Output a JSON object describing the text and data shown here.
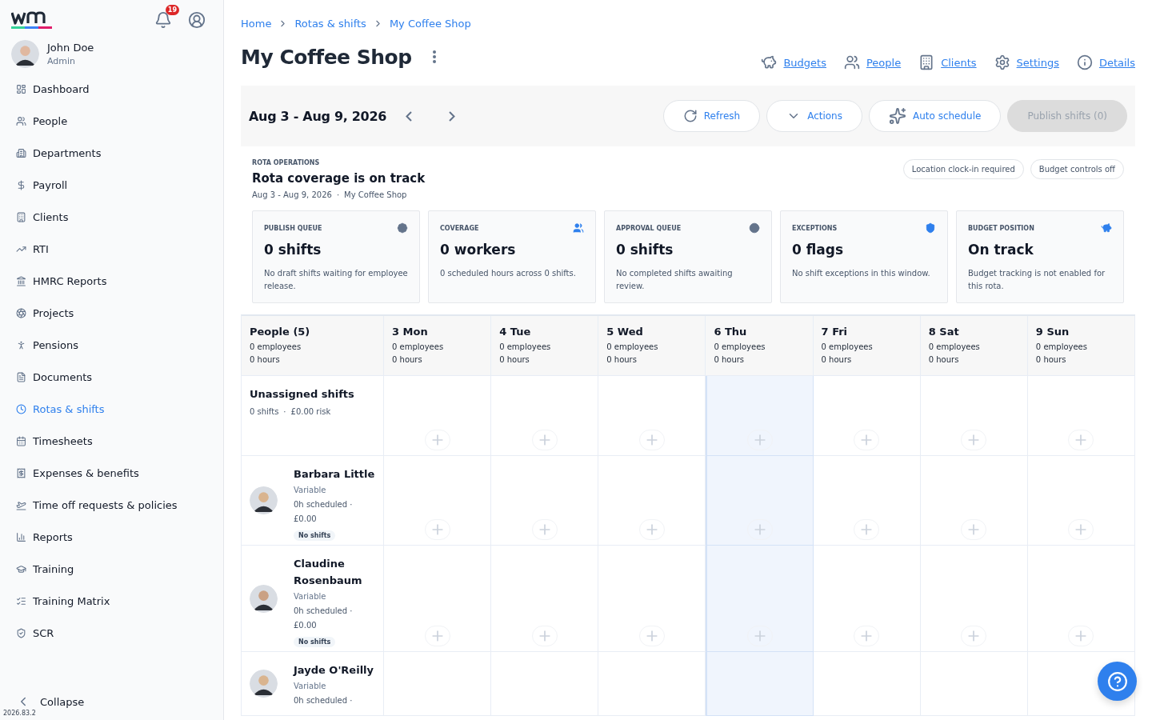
{
  "sidebar": {
    "notifications": "19",
    "user": {
      "name": "John Doe",
      "role": "Admin"
    },
    "items": [
      {
        "label": "Dashboard",
        "selected": false
      },
      {
        "label": "People",
        "selected": false
      },
      {
        "label": "Departments",
        "selected": false
      },
      {
        "label": "Payroll",
        "selected": false
      },
      {
        "label": "Clients",
        "selected": false
      },
      {
        "label": "RTI",
        "selected": false
      },
      {
        "label": "HMRC Reports",
        "selected": false
      },
      {
        "label": "Projects",
        "selected": false
      },
      {
        "label": "Pensions",
        "selected": false
      },
      {
        "label": "Documents",
        "selected": false
      },
      {
        "label": "Rotas & shifts",
        "selected": true
      },
      {
        "label": "Timesheets",
        "selected": false
      },
      {
        "label": "Expenses & benefits",
        "selected": false
      },
      {
        "label": "Time off requests & policies",
        "selected": false
      },
      {
        "label": "Reports",
        "selected": false
      },
      {
        "label": "Training",
        "selected": false
      },
      {
        "label": "Training Matrix",
        "selected": false
      },
      {
        "label": "SCR",
        "selected": false
      }
    ],
    "collapse": "Collapse",
    "version": "2026.83.2"
  },
  "breadcrumbs": [
    "Home",
    "Rotas & shifts",
    "My Coffee Shop"
  ],
  "title": "My Coffee Shop",
  "header_links": [
    "Budgets",
    "People",
    "Clients",
    "Settings",
    "Details"
  ],
  "toolbar": {
    "range": "Aug 3 - Aug 9, 2026",
    "buttons": [
      {
        "label": "Refresh",
        "disabled": false
      },
      {
        "label": "Actions",
        "disabled": false
      },
      {
        "label": "Auto schedule",
        "disabled": false
      },
      {
        "label": "Publish shifts (0)",
        "disabled": true
      }
    ]
  },
  "operations": {
    "eyebrow": "ROTA OPERATIONS",
    "heading": "Rota coverage is on track",
    "meta": [
      "Aug 3 - Aug 9, 2026",
      "My Coffee Shop"
    ],
    "meta_separator": "·",
    "tags": [
      "Location clock-in required",
      "Budget controls off"
    ],
    "cards": [
      {
        "label": "PUBLISH QUEUE",
        "value": "0 shifts",
        "description": "No draft shifts waiting for employee release.",
        "color": "#64748b"
      },
      {
        "label": "COVERAGE",
        "value": "0 workers",
        "description": "0 scheduled hours across 0 shifts.",
        "color": "#2f80ed"
      },
      {
        "label": "APPROVAL QUEUE",
        "value": "0 shifts",
        "description": "No completed shifts awaiting review.",
        "color": "#64748b"
      },
      {
        "label": "EXCEPTIONS",
        "value": "0 flags",
        "description": "No shift exceptions in this window.",
        "color": "#2f80ed"
      },
      {
        "label": "BUDGET POSITION",
        "value": "On track",
        "description": "Budget tracking is not enabled for this rota.",
        "color": "#2f80ed"
      }
    ]
  },
  "rota": {
    "people_header": {
      "title": "People (5)",
      "employees": "0 employees",
      "hours": "0 hours"
    },
    "days": [
      {
        "label": "3 Mon",
        "employees": "0 employees",
        "hours": "0 hours",
        "selected": false
      },
      {
        "label": "4 Tue",
        "employees": "0 employees",
        "hours": "0 hours",
        "selected": false
      },
      {
        "label": "5 Wed",
        "employees": "0 employees",
        "hours": "0 hours",
        "selected": false
      },
      {
        "label": "6 Thu",
        "employees": "0 employees",
        "hours": "0 hours",
        "selected": true
      },
      {
        "label": "7 Fri",
        "employees": "0 employees",
        "hours": "0 hours",
        "selected": false
      },
      {
        "label": "8 Sat",
        "employees": "0 employees",
        "hours": "0 hours",
        "selected": false
      },
      {
        "label": "9 Sun",
        "employees": "0 employees",
        "hours": "0 hours",
        "selected": false
      }
    ],
    "rows": [
      {
        "kind": "unassigned",
        "name": "Unassigned shifts",
        "shifts": "0 shifts",
        "separator": "·",
        "risk": "£0.00 risk"
      },
      {
        "kind": "person",
        "name": "Barbara Little",
        "contract": "Variable",
        "scheduled": "0h scheduled ·",
        "cost": "£0.00",
        "badge": "No shifts"
      },
      {
        "kind": "person",
        "name": "Claudine Rosenbaum",
        "contract": "Variable",
        "scheduled": "0h scheduled ·",
        "cost": "£0.00",
        "badge": "No shifts"
      },
      {
        "kind": "person",
        "name": "Jayde O'Reilly",
        "contract": "Variable",
        "scheduled": "0h scheduled ·"
      }
    ]
  }
}
